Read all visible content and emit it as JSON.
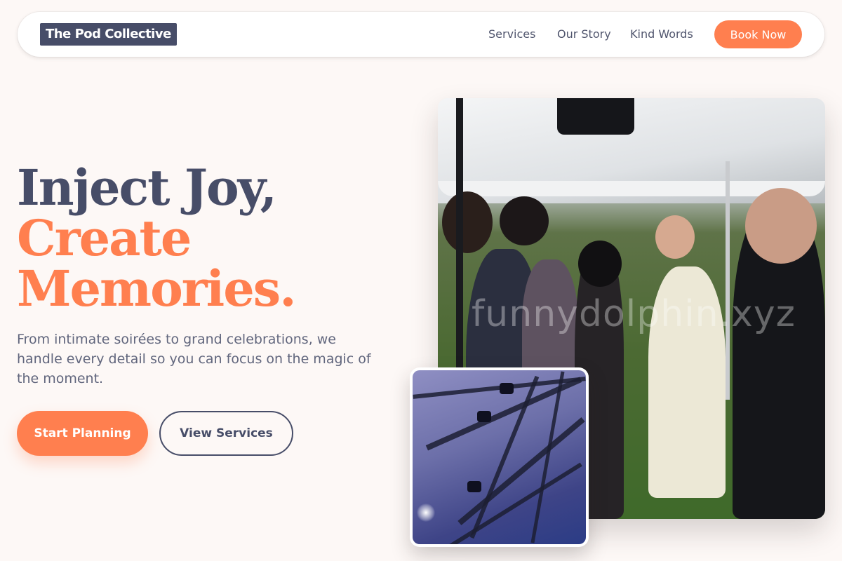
{
  "nav": {
    "logo": "The Pod Collective",
    "links": [
      "Services",
      "Our Story",
      "Kind Words"
    ],
    "cta": "Book Now"
  },
  "hero": {
    "headline_line1": "Inject Joy,",
    "headline_line2": "Create",
    "headline_line3": "Memories.",
    "lead": "From intimate soirées to grand celebrations, we handle every detail so you can focus on the magic of the moment.",
    "primary_button": "Start Planning",
    "secondary_button": "View Services"
  },
  "images": {
    "main_photo_watermark": "funnydolphin.xyz"
  },
  "colors": {
    "accent": "#ff7f4f",
    "navy": "#474d68",
    "background": "#fdf8f6"
  }
}
